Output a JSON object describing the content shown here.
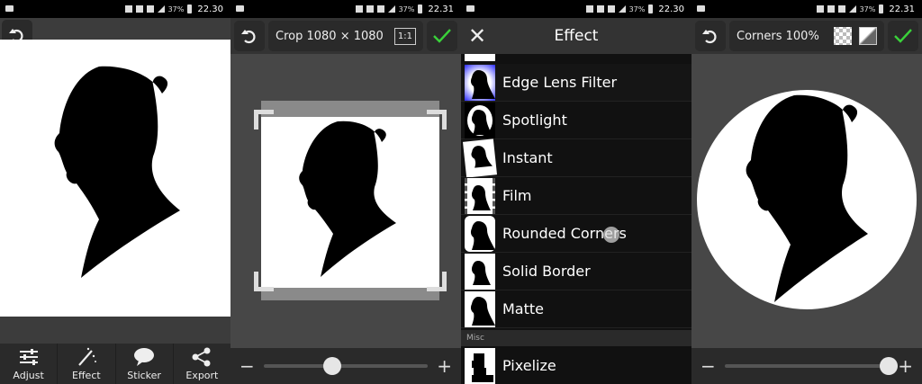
{
  "status": [
    {
      "time": "22.30",
      "signal": "37%"
    },
    {
      "time": "22.31",
      "signal": "37%"
    },
    {
      "time": "22.30",
      "signal": "37%"
    },
    {
      "time": "22.31",
      "signal": "37%"
    }
  ],
  "panel1": {
    "tools": [
      {
        "label": "Adjust",
        "icon": "sliders-icon"
      },
      {
        "label": "Effect",
        "icon": "magic-wand-icon"
      },
      {
        "label": "Sticker",
        "icon": "speech-bubble-icon"
      },
      {
        "label": "Export",
        "icon": "share-icon"
      }
    ]
  },
  "panel2": {
    "crop_label": "Crop 1080 × 1080",
    "ratio_label": "1:1",
    "minus": "−",
    "plus": "+",
    "slider_value": 0.42
  },
  "panel3": {
    "title": "Effect",
    "effects": [
      "Edge Lens Filter",
      "Spotlight",
      "Instant",
      "Film",
      "Rounded Corners",
      "Solid Border",
      "Matte"
    ],
    "section": "Misc",
    "misc_effects": [
      "Pixelize"
    ]
  },
  "panel4": {
    "corners_label": "Corners 100%",
    "minus": "−",
    "plus": "+",
    "slider_value": 1.0
  }
}
